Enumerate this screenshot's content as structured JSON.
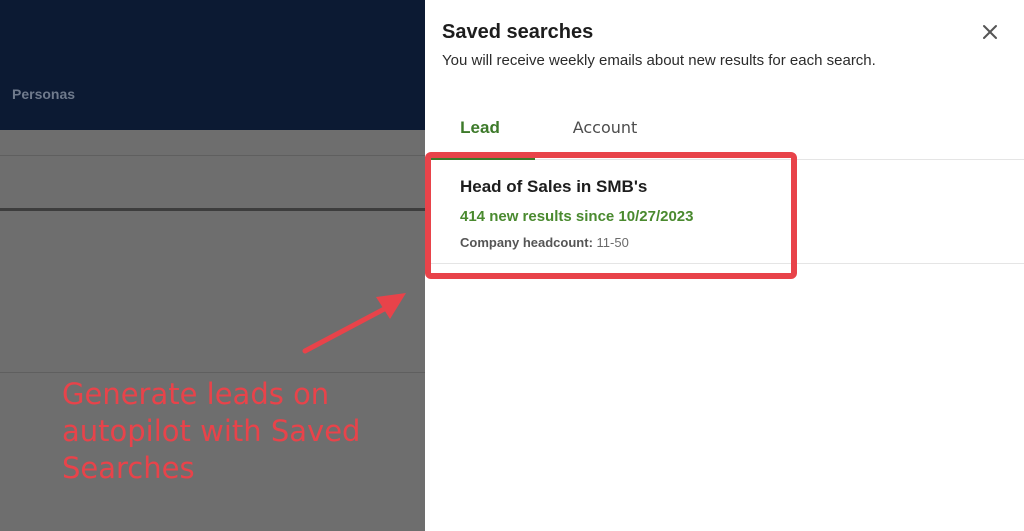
{
  "background": {
    "nav_label": "Personas"
  },
  "annotation": {
    "text": "Generate leads on autopilot with Saved Searches",
    "color": "#e8434a"
  },
  "panel": {
    "title": "Saved searches",
    "subtitle": "You will receive weekly emails about new results for each search.",
    "close_icon": "close-icon",
    "tabs": [
      {
        "label": "Lead",
        "active": true
      },
      {
        "label": "Account",
        "active": false
      }
    ],
    "results": [
      {
        "title": "Head of Sales in SMB's",
        "new_results": "414 new results since 10/27/2023",
        "meta_key": "Company headcount:",
        "meta_value": "11-50"
      }
    ]
  },
  "colors": {
    "accent_green": "#3d7a2a",
    "header_navy": "#0c1a33",
    "highlight_red": "#e8434a"
  }
}
